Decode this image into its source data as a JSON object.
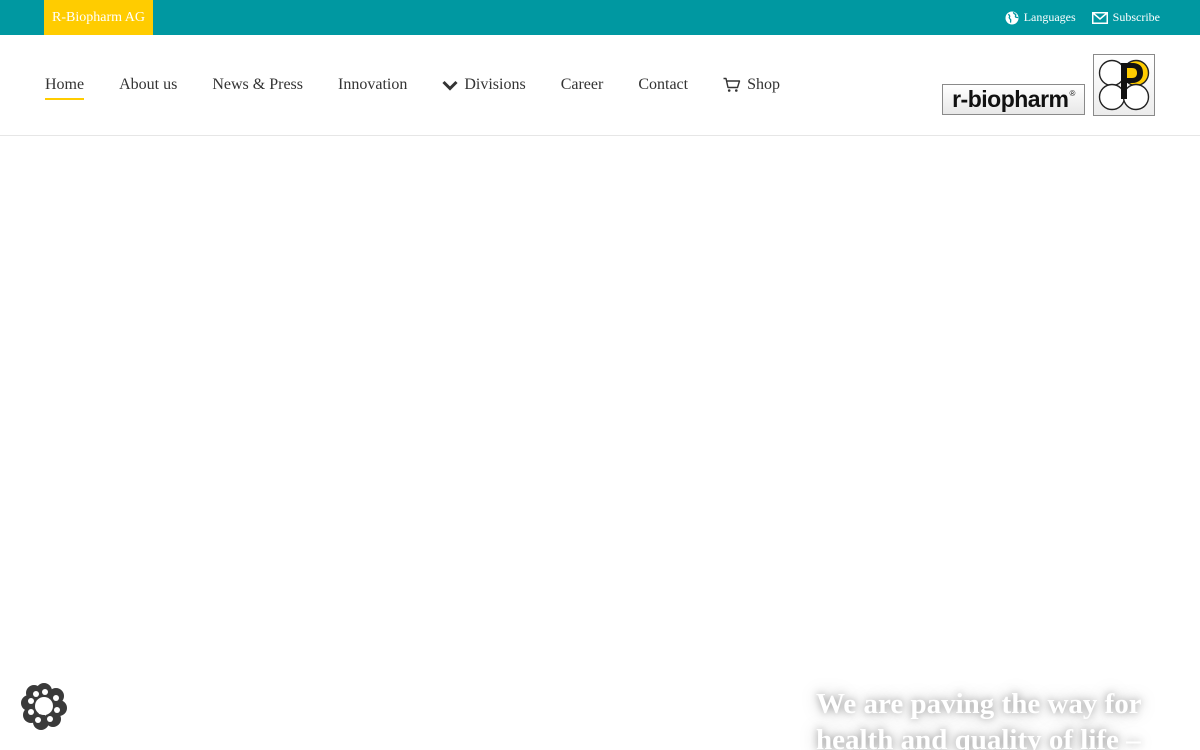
{
  "topbar": {
    "brand_tab": "R-Biopharm AG",
    "languages_label": "Languages",
    "subscribe_label": "Subscribe",
    "background_color": "#0098a1",
    "accent_color": "#ffcc00"
  },
  "nav": {
    "items": [
      {
        "label": "Home",
        "active": true
      },
      {
        "label": "About us"
      },
      {
        "label": "News & Press"
      },
      {
        "label": "Innovation"
      },
      {
        "label": "Divisions",
        "icon": "chevron-down-icon"
      },
      {
        "label": "Career"
      },
      {
        "label": "Contact"
      },
      {
        "label": "Shop",
        "icon": "cart-icon"
      }
    ]
  },
  "logo": {
    "wordmark": "r-biopharm",
    "registered": "®"
  },
  "hero": {
    "line1": "We are paving the way for",
    "line2": "health and quality of life –"
  },
  "cookie": {
    "icon": "cookie-settings-icon"
  }
}
